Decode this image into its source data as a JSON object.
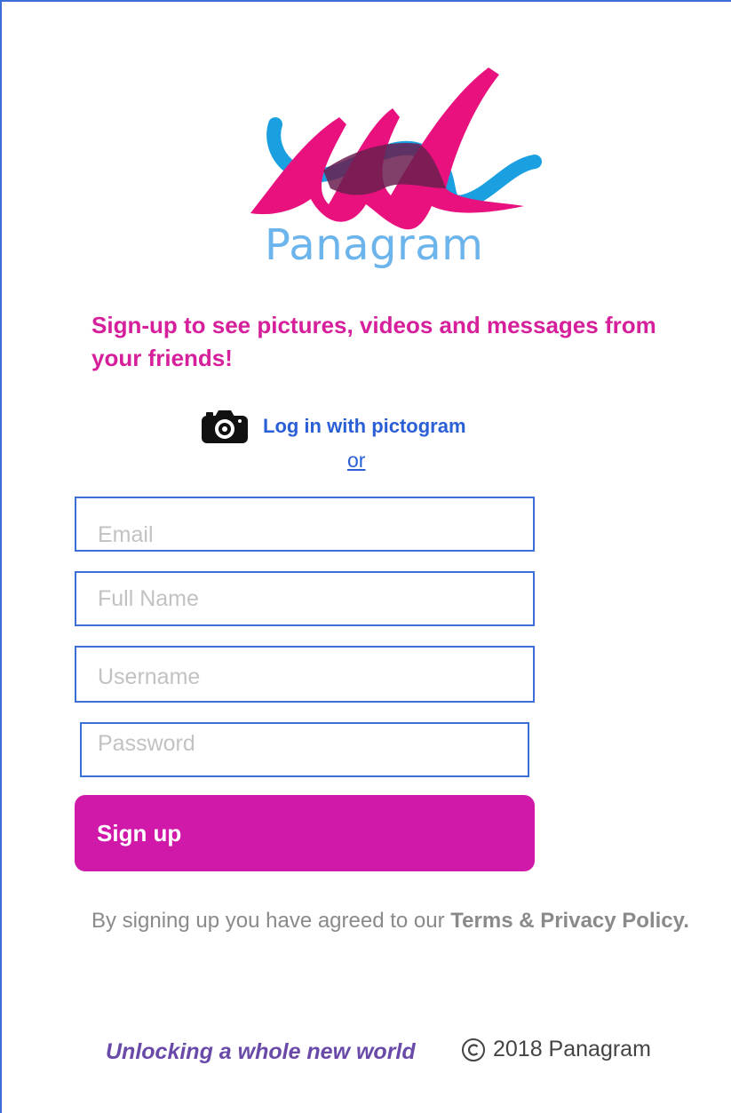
{
  "brand": {
    "name": "Panagram",
    "colors": {
      "pink": "#d61f9a",
      "magenta_button": "#d019a8",
      "blue": "#2a5fd6",
      "logo_blue": "#6cb4ec",
      "logo_cyan": "#1aa0e0"
    }
  },
  "tagline": "Sign-up to see pictures, videos and messages from your friends!",
  "pictogram": {
    "icon": "camera-icon",
    "label": "Log in with pictogram"
  },
  "divider": "or",
  "form": {
    "email_placeholder": "Email",
    "fullname_placeholder": "Full Name",
    "username_placeholder": "Username",
    "password_placeholder": "Password",
    "submit_label": "Sign up"
  },
  "terms": {
    "prefix": "By signing up you have agreed to our ",
    "link": "Terms & Privacy Policy."
  },
  "footer": {
    "slogan": "Unlocking a whole new world",
    "copyright_icon": "copyright-icon",
    "copyright_text": "2018 Panagram"
  }
}
